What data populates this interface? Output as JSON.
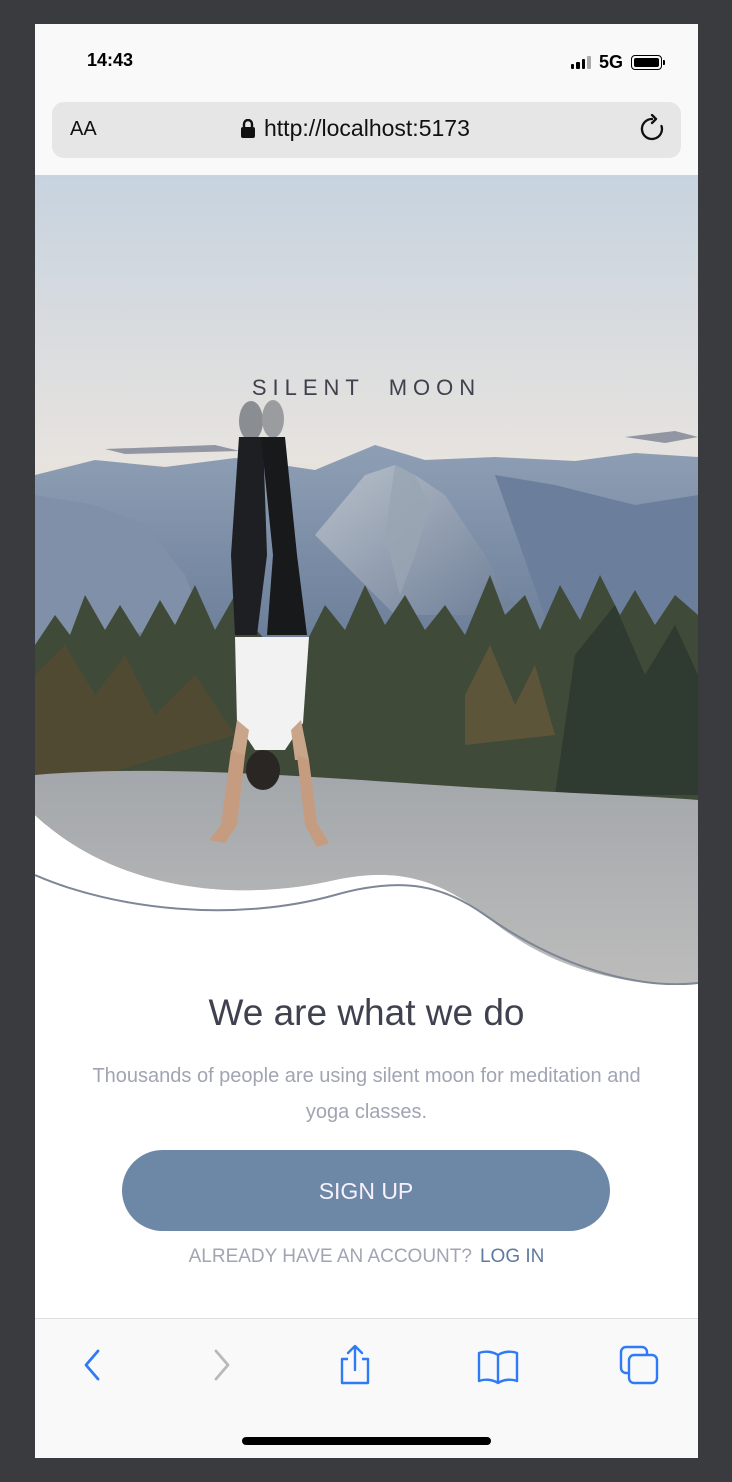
{
  "status_bar": {
    "time": "14:43",
    "network": "5G"
  },
  "browser": {
    "text_size_label": "AA",
    "url": "http://localhost:5173"
  },
  "hero": {
    "brand": "SILENT  MOON"
  },
  "main": {
    "heading": "We are what we do",
    "description": "Thousands of people are using silent moon for meditation and yoga classes.",
    "signup_label": "SIGN UP",
    "account_prompt": "ALREADY HAVE AN ACCOUNT?",
    "login_label": "LOG IN"
  },
  "colors": {
    "accent": "#6d87a6",
    "heading": "#3f414e",
    "muted": "#a1a4b2",
    "link": "#5f7aa0",
    "toolbar_icons": "#2f7bf6"
  },
  "icons": {
    "toolbar": [
      "back-icon",
      "forward-icon",
      "share-icon",
      "bookmarks-icon",
      "tabs-icon"
    ]
  }
}
